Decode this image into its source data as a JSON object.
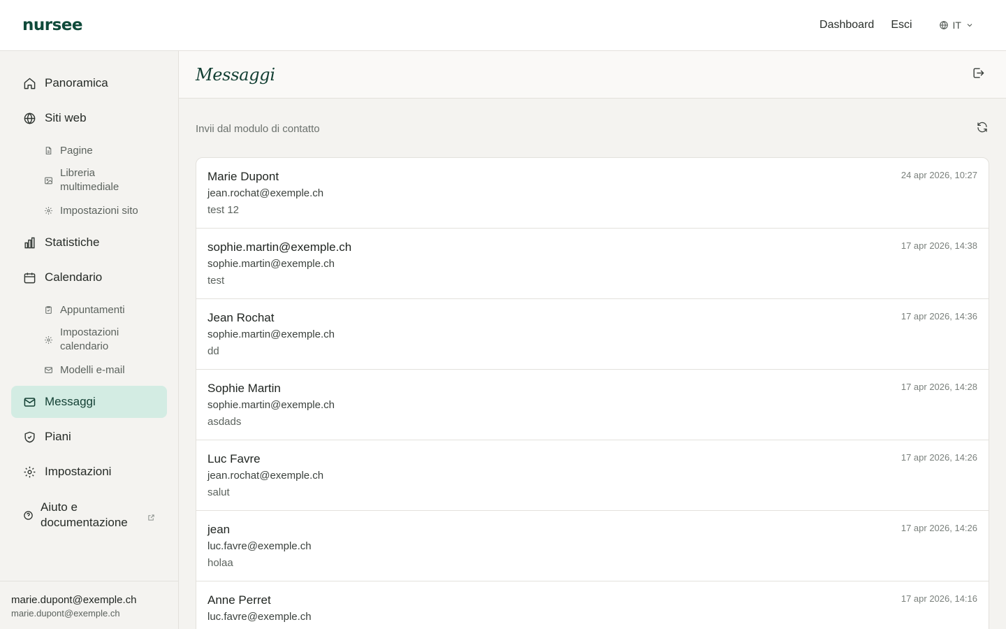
{
  "header": {
    "logo": "nursee",
    "nav": {
      "dashboard": "Dashboard",
      "logout": "Esci"
    },
    "language": "IT"
  },
  "sidebar": {
    "items": [
      {
        "label": "Panoramica",
        "icon": "home-icon"
      },
      {
        "label": "Siti web",
        "icon": "globe-icon"
      },
      {
        "label": "Statistiche",
        "icon": "bar-chart-icon"
      },
      {
        "label": "Calendario",
        "icon": "calendar-icon"
      },
      {
        "label": "Messaggi",
        "icon": "mail-icon",
        "active": true
      },
      {
        "label": "Piani",
        "icon": "shield-icon"
      },
      {
        "label": "Impostazioni",
        "icon": "gear-icon"
      }
    ],
    "sites_sub": [
      {
        "label": "Pagine",
        "icon": "document-icon"
      },
      {
        "label": "Libreria multimediale",
        "icon": "image-icon"
      },
      {
        "label": "Impostazioni sito",
        "icon": "gear-icon"
      }
    ],
    "calendar_sub": [
      {
        "label": "Appuntamenti",
        "icon": "clipboard-icon"
      },
      {
        "label": "Impostazioni calendario",
        "icon": "gear-icon"
      },
      {
        "label": "Modelli e-mail",
        "icon": "mail-icon"
      }
    ],
    "help": {
      "label": "Aiuto e documentazione",
      "icon": "help-circle-icon"
    },
    "user": {
      "name": "marie.dupont@exemple.ch",
      "email": "marie.dupont@exemple.ch"
    }
  },
  "main": {
    "title": "Messaggi",
    "section_title": "Invii dal modulo di contatto",
    "messages": [
      {
        "name": "Marie Dupont",
        "email": "jean.rochat@exemple.ch",
        "body": "test 12",
        "date": "24 apr 2026, 10:27"
      },
      {
        "name": "sophie.martin@exemple.ch",
        "email": "sophie.martin@exemple.ch",
        "body": "test",
        "date": "17 apr 2026, 14:38"
      },
      {
        "name": "Jean Rochat",
        "email": "sophie.martin@exemple.ch",
        "body": "dd",
        "date": "17 apr 2026, 14:36"
      },
      {
        "name": "Sophie Martin",
        "email": "sophie.martin@exemple.ch",
        "body": "asdads",
        "date": "17 apr 2026, 14:28"
      },
      {
        "name": "Luc Favre",
        "email": "jean.rochat@exemple.ch",
        "body": "salut",
        "date": "17 apr 2026, 14:26"
      },
      {
        "name": "jean",
        "email": "luc.favre@exemple.ch",
        "body": "holaa",
        "date": "17 apr 2026, 14:26"
      },
      {
        "name": "Anne Perret",
        "email": "luc.favre@exemple.ch",
        "body": "",
        "date": "17 apr 2026, 14:16"
      }
    ]
  },
  "colors": {
    "accent": "#0f4a3a",
    "active_bg": "#d3ece3",
    "background": "#f4f3f0"
  }
}
